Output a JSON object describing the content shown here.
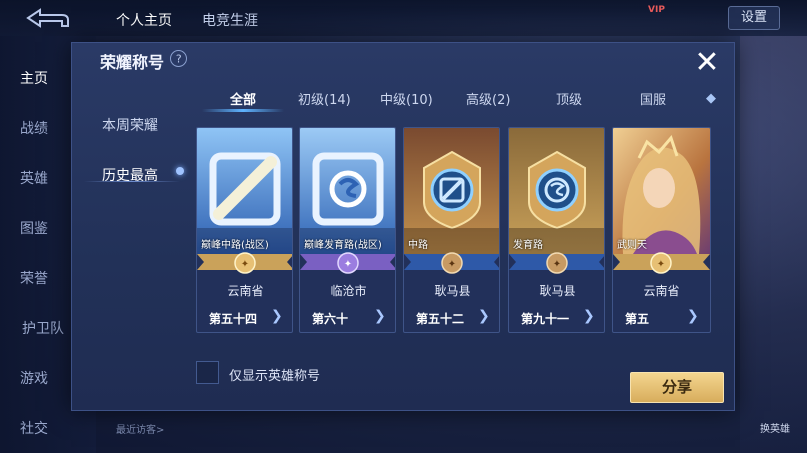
{
  "topbar": {
    "tabs": [
      "个人主页",
      "电竞生涯"
    ],
    "settings_label": "设置",
    "badge_text": "VIP"
  },
  "left_rail": {
    "items": [
      "主页",
      "战绩",
      "英雄",
      "图鉴",
      "荣誉",
      "护卫队",
      "游戏",
      "社交"
    ]
  },
  "visitors_label": "最近访客>",
  "right_labels": [
    "换英雄"
  ],
  "modal": {
    "title": "荣耀称号",
    "help_glyph": "?",
    "close_glyph": "✕",
    "side_nav": [
      "本周荣耀",
      "历史最高"
    ],
    "tabs": [
      "全部",
      "初级(14)",
      "中级(10)",
      "高级(2)",
      "顶级",
      "国服"
    ],
    "cards": [
      {
        "name": "巅峰中路(战区)",
        "region": "云南省",
        "rank": "第五十四",
        "art": "icon-square",
        "ribbon": "gold"
      },
      {
        "name": "巅峰发育路(战区)",
        "region": "临沧市",
        "rank": "第六十",
        "art": "icon-s",
        "ribbon": "purple"
      },
      {
        "name": "中路",
        "region": "耿马县",
        "rank": "第五十二",
        "art": "badge-slash",
        "ribbon": "bronze"
      },
      {
        "name": "发育路",
        "region": "耿马县",
        "rank": "第九十一",
        "art": "badge-s",
        "ribbon": "bronze"
      },
      {
        "name": "武则天",
        "region": "云南省",
        "rank": "第五",
        "art": "hero-portrait",
        "ribbon": "gold"
      }
    ],
    "checkbox_label": "仅显示英雄称号",
    "share_label": "分享"
  },
  "colors": {
    "gold": "#e7c074",
    "purple": "#9b7de0",
    "bronze": "#c79a63",
    "accent_blue": "#5fb4ff"
  }
}
